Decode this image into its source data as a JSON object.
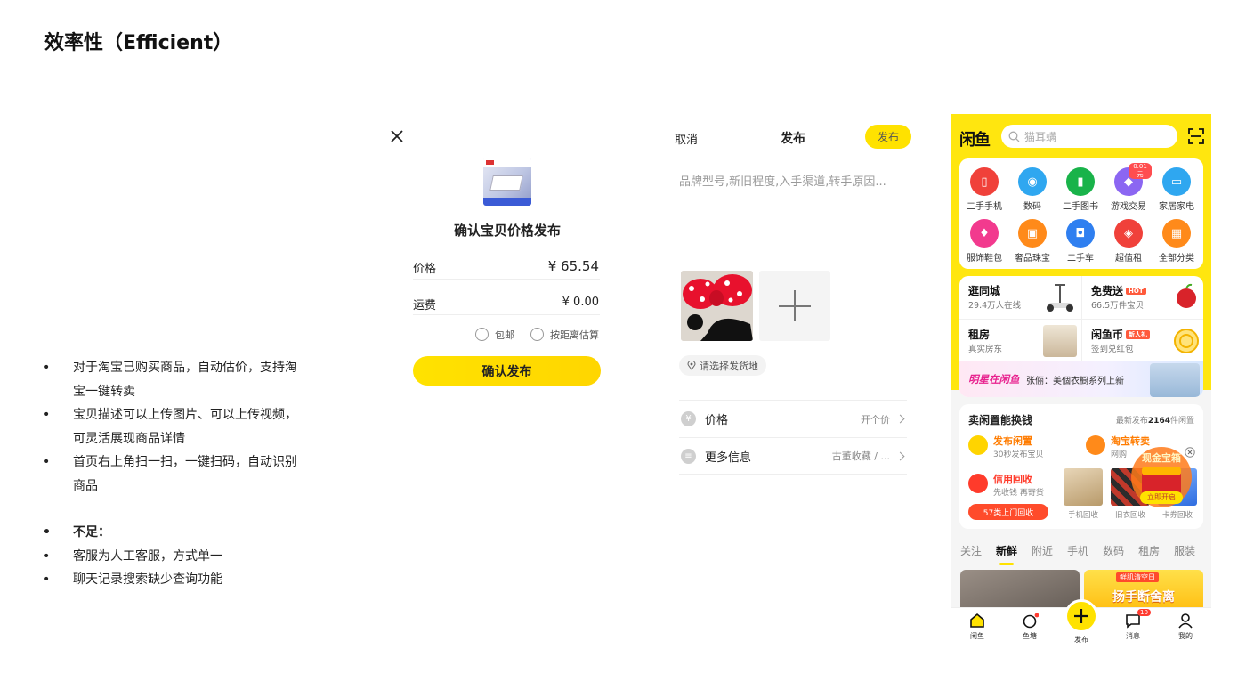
{
  "page": {
    "title": "效率性（Efficient）"
  },
  "notes": {
    "items": [
      "对于淘宝已购买商品，自动估价，支持淘宝一键转卖",
      "宝贝描述可以上传图片、可以上传视频，可灵活展现商品详情",
      "首页右上角扫一扫，一键扫码，自动识别商品"
    ],
    "cons_title": "不足：",
    "cons": [
      "客服为人工客服，方式单一",
      "聊天记录搜索缺少查询功能"
    ]
  },
  "confirm_screen": {
    "close_icon": "close-icon",
    "title": "确认宝贝价格发布",
    "price_label": "价格",
    "price_value": "¥ 65.54",
    "shipping_label": "运费",
    "shipping_value": "¥ 0.00",
    "option_free_shipping": "包邮",
    "option_by_distance": "按距离估算",
    "confirm_button": "确认发布",
    "accent": "#FFE200"
  },
  "publish_screen": {
    "cancel": "取消",
    "title": "发布",
    "publish_button": "发布",
    "description_placeholder": "品牌型号,新旧程度,入手渠道,转手原因...",
    "location_chip": "请选择发货地",
    "rows": [
      {
        "label": "价格",
        "value": "开个价",
        "icon": "yen-icon"
      },
      {
        "label": "更多信息",
        "value": "古董收藏 / ...",
        "icon": "list-icon"
      }
    ]
  },
  "home_screen": {
    "logo": "闲鱼",
    "search_placeholder": "猫耳螨",
    "categories": [
      {
        "label": "二手手机",
        "color": "#F0413A",
        "glyph": "▯"
      },
      {
        "label": "数码",
        "color": "#2FA7F0",
        "glyph": "◉"
      },
      {
        "label": "二手图书",
        "color": "#19B34A",
        "glyph": "▮"
      },
      {
        "label": "游戏交易",
        "color": "#8B66F2",
        "glyph": "◆",
        "badge": "0.01元"
      },
      {
        "label": "家居家电",
        "color": "#2FA7F0",
        "glyph": "▭"
      },
      {
        "label": "服饰鞋包",
        "color": "#F23A8E",
        "glyph": "♦"
      },
      {
        "label": "奢品珠宝",
        "color": "#FF8A1A",
        "glyph": "▣"
      },
      {
        "label": "二手车",
        "color": "#2F7FF0",
        "glyph": "◘"
      },
      {
        "label": "超值租",
        "color": "#F0413A",
        "glyph": "◈"
      },
      {
        "label": "全部分类",
        "color": "#FF8A1A",
        "glyph": "▦"
      }
    ],
    "promos": [
      {
        "title": "逛同城",
        "sub": "29.4万人在线"
      },
      {
        "title": "免费送",
        "tag": "HOT",
        "sub": "66.5万件宝贝"
      },
      {
        "title": "租房",
        "sub": "真实房东"
      },
      {
        "title": "闲鱼币",
        "tag": "新人礼",
        "sub": "签到兑红包"
      }
    ],
    "star_banner": {
      "brand": "明星在闲鱼",
      "text": "张俪：美個衣橱系列上新"
    },
    "trade": {
      "title": "卖闲置能换钱",
      "stat_prefix": "最新发布",
      "stat_count": "2164",
      "stat_suffix": "件闲置",
      "items": [
        {
          "title": "发布闲置",
          "sub": "30秒发布宝贝"
        },
        {
          "title": "淘宝转卖",
          "sub": "网购"
        },
        {
          "title": "信用回收",
          "sub": "先收钱 再寄货"
        }
      ],
      "cta": "57类上门回收",
      "product_labels": [
        "手机回收",
        "旧衣回收",
        "卡券回收"
      ],
      "float_ad": {
        "title": "现金宝箱",
        "cta": "立即开启"
      }
    },
    "feed_tabs": [
      "关注",
      "新鲜",
      "附近",
      "手机",
      "数码",
      "租房",
      "服装"
    ],
    "active_tab": "新鲜",
    "feed_banner_right": {
      "top": "鲜肌清空日",
      "main": "扬手断舍离"
    },
    "tabbar": [
      {
        "label": "闲鱼",
        "icon": "home-icon"
      },
      {
        "label": "鱼塘",
        "icon": "pond-icon"
      },
      {
        "label": "发布",
        "icon": "plus-icon"
      },
      {
        "label": "消息",
        "icon": "message-icon",
        "badge": "10"
      },
      {
        "label": "我的",
        "icon": "profile-icon"
      }
    ]
  }
}
